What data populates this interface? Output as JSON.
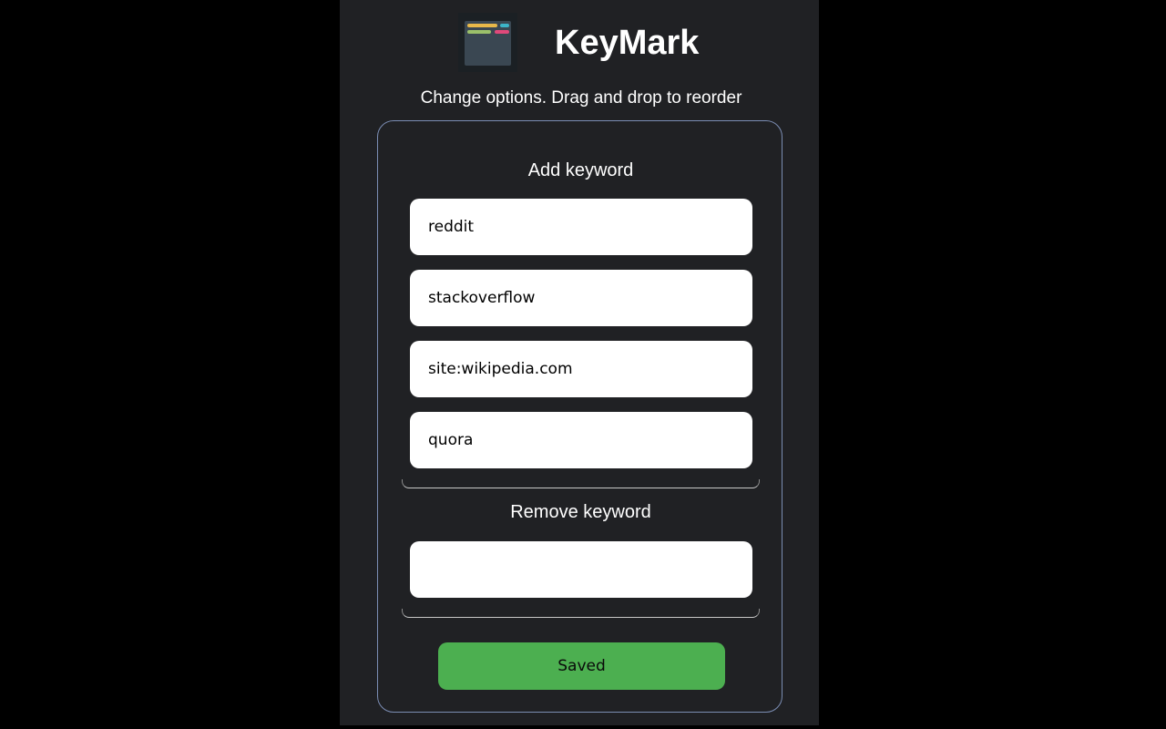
{
  "app": {
    "title": "KeyMark",
    "subtitle": "Change options. Drag and drop to reorder",
    "logo_icon": "notes-list-icon"
  },
  "add_section": {
    "heading": "Add keyword",
    "keywords": [
      "reddit",
      "stackoverflow",
      "site:wikipedia.com",
      "quora"
    ]
  },
  "remove_section": {
    "heading": "Remove keyword",
    "value": ""
  },
  "save_button": {
    "label": "Saved"
  },
  "colors": {
    "background": "#000000",
    "panel": "#202124",
    "box_border": "#7b8db3",
    "save_button": "#4caf50",
    "logo_bar_yellow": "#e8b94a",
    "logo_bar_teal": "#3cb4c8",
    "logo_bar_green": "#9bc06a",
    "logo_bar_pink": "#e0497a"
  }
}
